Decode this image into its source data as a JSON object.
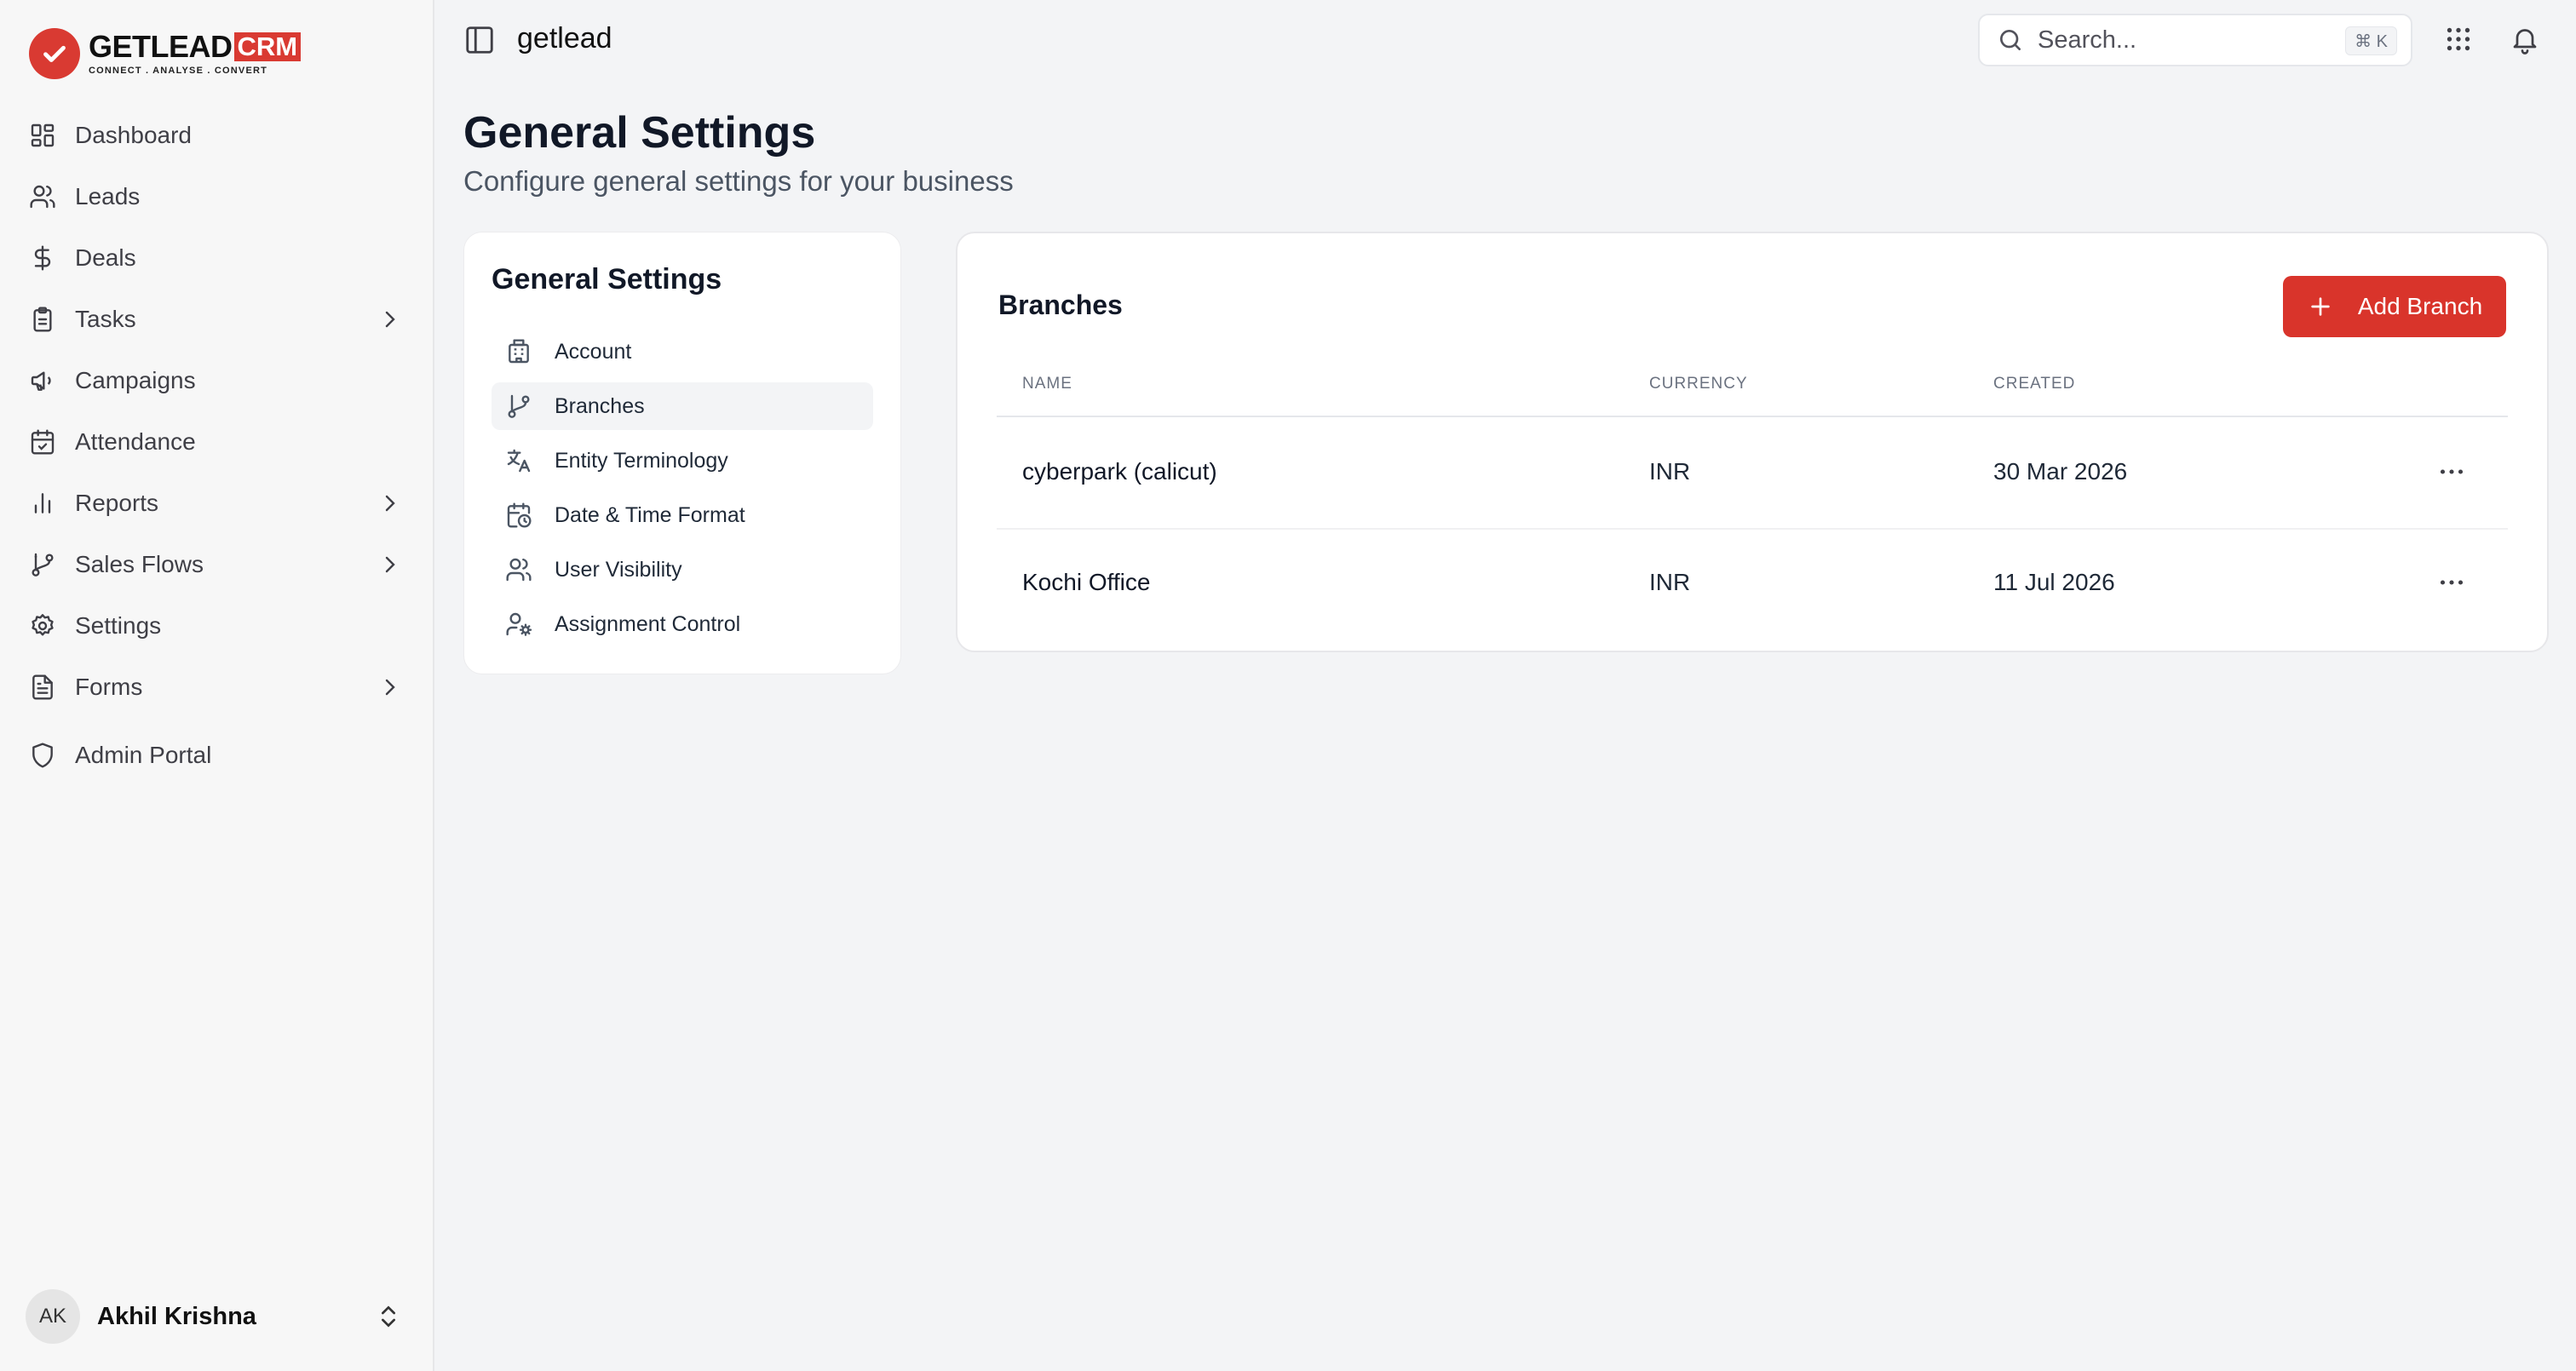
{
  "brand": {
    "word": "GETLEAD",
    "crm": "CRM",
    "tagline": "CONNECT . ANALYSE . CONVERT",
    "accent": "#d93a32"
  },
  "sidebar": {
    "items": [
      {
        "label": "Dashboard",
        "icon": "dashboard-icon"
      },
      {
        "label": "Leads",
        "icon": "users-icon"
      },
      {
        "label": "Deals",
        "icon": "dollar-icon"
      },
      {
        "label": "Tasks",
        "icon": "clipboard-icon",
        "has_submenu": true
      },
      {
        "label": "Campaigns",
        "icon": "megaphone-icon"
      },
      {
        "label": "Attendance",
        "icon": "calendar-check-icon"
      },
      {
        "label": "Reports",
        "icon": "bar-chart-icon",
        "has_submenu": true
      },
      {
        "label": "Sales Flows",
        "icon": "git-branch-icon",
        "has_submenu": true
      },
      {
        "label": "Settings",
        "icon": "gear-icon"
      },
      {
        "label": "Forms",
        "icon": "file-text-icon",
        "has_submenu": true
      },
      {
        "label": "Admin Portal",
        "icon": "shield-icon"
      }
    ],
    "user": {
      "initials": "AK",
      "name": "Akhil Krishna"
    }
  },
  "topbar": {
    "title": "getlead",
    "search_placeholder": "Search...",
    "search_shortcut": "⌘ K"
  },
  "page": {
    "title": "General Settings",
    "subtitle": "Configure general settings for your business"
  },
  "settings_nav": {
    "title": "General Settings",
    "items": [
      {
        "label": "Account",
        "icon": "building-icon"
      },
      {
        "label": "Branches",
        "icon": "git-branch-icon",
        "active": true
      },
      {
        "label": "Entity Terminology",
        "icon": "translate-icon"
      },
      {
        "label": "Date & Time Format",
        "icon": "calendar-clock-icon"
      },
      {
        "label": "User Visibility",
        "icon": "users-icon"
      },
      {
        "label": "Assignment Control",
        "icon": "user-cog-icon"
      }
    ]
  },
  "branches": {
    "title": "Branches",
    "add_label": "Add Branch",
    "columns": [
      "NAME",
      "CURRENCY",
      "CREATED"
    ],
    "rows": [
      {
        "name": "cyberpark (calicut)",
        "currency": "INR",
        "created": "30 Mar 2026"
      },
      {
        "name": "Kochi Office",
        "currency": "INR",
        "created": "11 Jul 2026"
      }
    ]
  }
}
